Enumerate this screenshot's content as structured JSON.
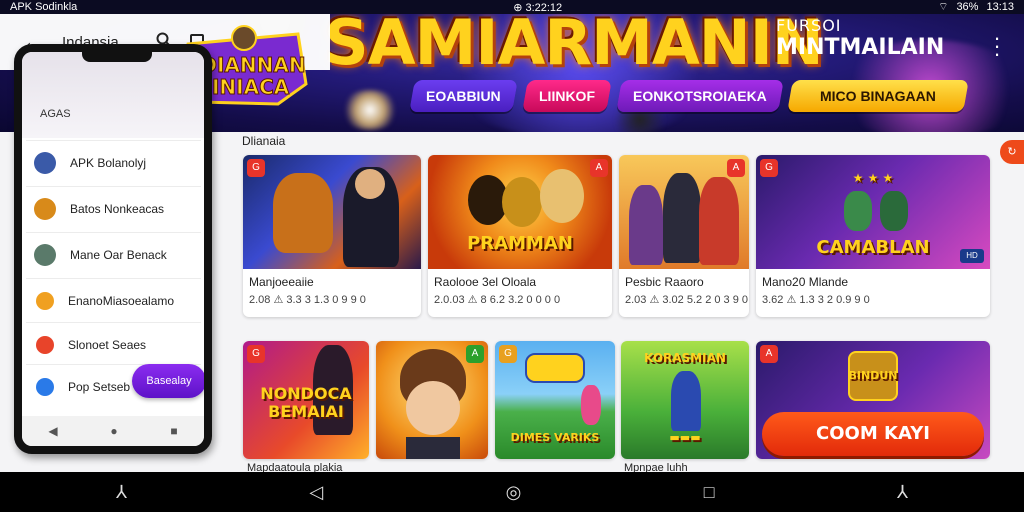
{
  "status_bar": {
    "left": "APK Sodinkla",
    "center": "⊕ 3:22:12",
    "battery": "36%",
    "time": "13:13"
  },
  "app_bar": {
    "title": "Indansia"
  },
  "logo": {
    "line1": "MDIANNAN",
    "line2": "BINIACA"
  },
  "banner": {
    "title": "SAMIARMANIN",
    "sub_small": "FURSOI",
    "sub_big": "MINTMAILAIN",
    "chips": [
      "EOABBIUN",
      "LIINKOF",
      "EONKOTSROIAEKA",
      "MICO BINAGAAN"
    ]
  },
  "phone": {
    "label": "AGAS",
    "items": [
      {
        "label": "APK Bolanolyj",
        "color": "#3a5aa8"
      },
      {
        "label": "Batos Nonkeacas",
        "color": "#d88a1a"
      },
      {
        "label": "Mane Oar Benack",
        "color": "#5a7a6a"
      },
      {
        "label": "EnanoMiasoealamo",
        "color": "#f0a020"
      },
      {
        "label": "Slonoet Seaes",
        "color": "#e8442a"
      },
      {
        "label": "Pop Setseb",
        "color": "#2a7ae8"
      }
    ],
    "fab_label": "Basealay",
    "nav": [
      "◀",
      "●",
      "■"
    ]
  },
  "section": {
    "title": "Dlianaia"
  },
  "cards_row1": [
    {
      "name": "Manjoeeaiie",
      "meta": "2.08 ⚠ 3.3 3 1.3 0 9 9 0",
      "badge": "G"
    },
    {
      "name": "Raolooe 3el Oloala",
      "meta": "2.0.03 ⚠ 8 6.2 3.2 0 0 0 0",
      "badge": "A",
      "art_text": "PRAMMAN"
    },
    {
      "name": "Pesbic Raaoro",
      "meta": "2.03 ⚠ 3.02 5.2 2 0 3 9 0",
      "badge": "A"
    },
    {
      "name": "Mano20 Mlande",
      "meta": "3.62 ⚠ 1.3 3 2 0.9 9 0",
      "badge": "G",
      "art_text": "CAMABLAN"
    }
  ],
  "cards_row2": [
    {
      "name": "Mapdaatoula plakia",
      "badge": "G",
      "art_text": "NONDOCA BEMAIAI"
    },
    {
      "name": "",
      "badge": "A"
    },
    {
      "name": "",
      "badge": "G",
      "art_text": "DIMES VARIKS"
    },
    {
      "name": "Mpnpae luhh",
      "badge": "A",
      "art_text": "KORASMIAN"
    },
    {
      "name": "",
      "badge": "A",
      "art_text": "BINDUN"
    }
  ],
  "cta": {
    "label": "COOM KAYI"
  },
  "round_badge": "↻",
  "sys_nav": [
    "⅄",
    "◁",
    "◎",
    "□",
    "⅄"
  ]
}
